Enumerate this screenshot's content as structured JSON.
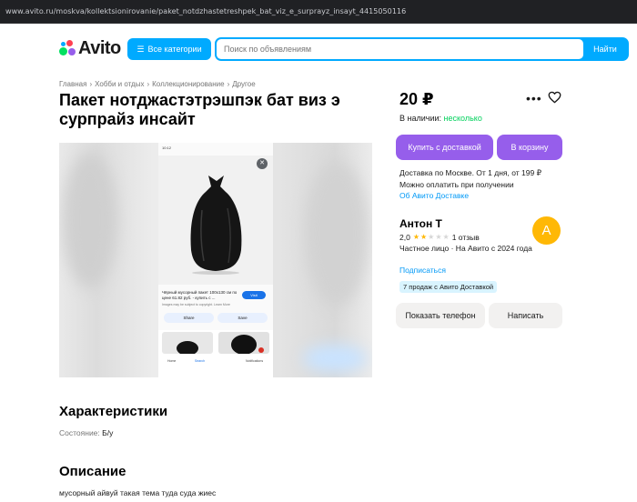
{
  "browser": {
    "url": "www.avito.ru/moskva/kollektsionirovanie/paket_notdzhastetreshpek_bat_viz_e_surprayz_insayt_4415050116"
  },
  "header": {
    "logo": "Avito",
    "categories_label": "Все категории",
    "search_placeholder": "Поиск по объявлениям",
    "search_button": "Найти"
  },
  "breadcrumbs": [
    "Главная",
    "Хобби и отдых",
    "Коллекционирование",
    "Другое"
  ],
  "breadcrumb_sep": "›",
  "listing": {
    "title": "Пакет нотджастэтрэшпэк бат виз э сурпрайз инсайт",
    "price": "20 ₽",
    "availability_label": "В наличии:",
    "availability_value": "несколько"
  },
  "photo": {
    "status_time": "10:12",
    "caption": "Чёрный мусорный пакет 100x130 см по цене 61.82 руб. - купить с ...",
    "caption_note": "Images may be subject to copyright. Learn More",
    "visit": "Visit",
    "share": "Share",
    "save": "Save",
    "nav_home": "Home",
    "nav_search": "Search",
    "nav_notif": "Notifications"
  },
  "actions": {
    "buy": "Купить с доставкой",
    "cart": "В корзину"
  },
  "delivery": {
    "line1": "Доставка по Москве. От 1 дня, от 199 ₽",
    "line2": "Можно оплатить при получении",
    "link": "Об Авито Доставке"
  },
  "seller": {
    "name": "Антон Т",
    "rating": "2,0",
    "stars_filled": 2,
    "stars_total": 5,
    "reviews": "1 отзыв",
    "info": "Частное лицо · На Авито с 2024 года",
    "subscribe": "Подписаться",
    "avatar_letter": "А",
    "badge": "7 продаж с Авито Доставкой",
    "show_phone": "Показать телефон",
    "write": "Написать"
  },
  "characteristics": {
    "title": "Характеристики",
    "condition_label": "Состояние:",
    "condition_value": "Б/у"
  },
  "description": {
    "title": "Описание",
    "text": "мусорный айвуй такая тема туда суда жиес"
  },
  "colors": {
    "accent": "#00aaff",
    "purple": "#965eeb",
    "green": "#02d15c",
    "avatar": "#ffb805",
    "star": "#ffb805"
  }
}
